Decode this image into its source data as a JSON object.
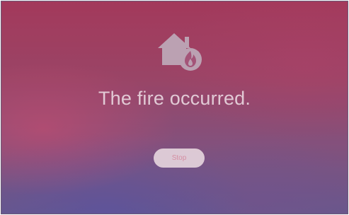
{
  "alert": {
    "icon": "house-fire-icon",
    "message": "The fire occurred.",
    "stop_label": "Stop"
  },
  "colors": {
    "text": "#ecdce4",
    "button_bg": "#e9dae0",
    "button_text": "#d58ea2"
  }
}
